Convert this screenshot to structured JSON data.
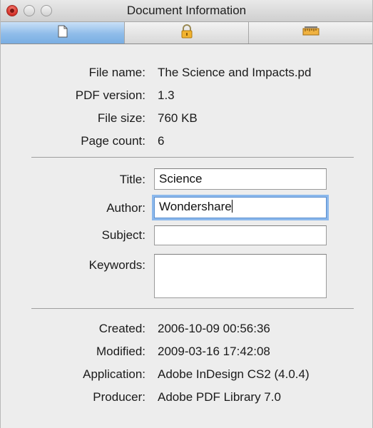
{
  "window": {
    "title": "Document Information"
  },
  "tabs": [
    {
      "icon": "document-icon",
      "active": true
    },
    {
      "icon": "lock-icon",
      "active": false
    },
    {
      "icon": "ruler-icon",
      "active": false
    }
  ],
  "info": {
    "file_name_label": "File name:",
    "file_name": "The Science and Impacts.pd",
    "pdf_version_label": "PDF version:",
    "pdf_version": "1.3",
    "file_size_label": "File size:",
    "file_size": "760 KB",
    "page_count_label": "Page count:",
    "page_count": "6"
  },
  "fields": {
    "title_label": "Title:",
    "title_value": "Science",
    "author_label": "Author:",
    "author_value": "Wondershare",
    "subject_label": "Subject:",
    "subject_value": "",
    "keywords_label": "Keywords:",
    "keywords_value": ""
  },
  "dates": {
    "created_label": "Created:",
    "created": "2006-10-09 00:56:36",
    "modified_label": "Modified:",
    "modified": "2009-03-16 17:42:08",
    "application_label": "Application:",
    "application": "Adobe InDesign CS2 (4.0.4)",
    "producer_label": "Producer:",
    "producer": "Adobe PDF Library 7.0"
  },
  "colors": {
    "active_tab": "#8fbce9",
    "focus_ring": "#8bb8ec",
    "close_button": "#d7332a"
  }
}
